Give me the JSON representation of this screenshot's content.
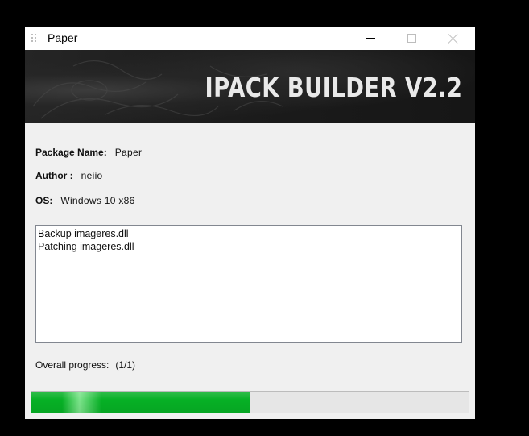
{
  "window": {
    "title": "Paper",
    "controls": {
      "minimize_icon": "minimize-icon",
      "maximize_icon": "maximize-icon",
      "close_icon": "close-icon"
    }
  },
  "banner": {
    "title": "IPACK BUILDER V2.2"
  },
  "info": {
    "package_label": "Package Name:",
    "package_value": "Paper",
    "author_label": "Author :",
    "author_value": "neiio",
    "os_label": "OS:",
    "os_value": "Windows 10 x86"
  },
  "log": {
    "lines": [
      "Backup imageres.dll",
      "Patching imageres.dll"
    ]
  },
  "progress": {
    "label": "Overall progress:",
    "count": "(1/1)",
    "fraction": 0.5,
    "fill_color": "#06b025"
  }
}
